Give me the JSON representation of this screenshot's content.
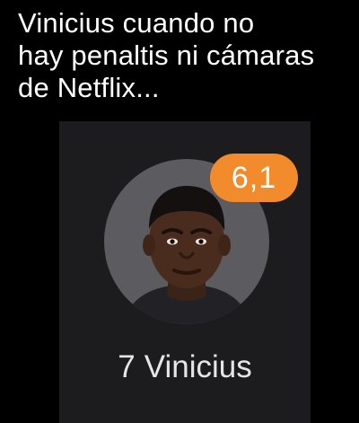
{
  "caption": {
    "line1": "Vinicius cuando no",
    "line2": "hay penaltis ni cámaras",
    "line3": "de Netflix..."
  },
  "player": {
    "number": "7",
    "name": "Vinicius",
    "rating": "6,1",
    "photo_icon": "player-headshot-icon"
  },
  "colors": {
    "background": "#000000",
    "card": "#1c1c1e",
    "avatar_circle": "#5c5c60",
    "rating_badge": "#f28b2c",
    "text": "#ffffff"
  }
}
